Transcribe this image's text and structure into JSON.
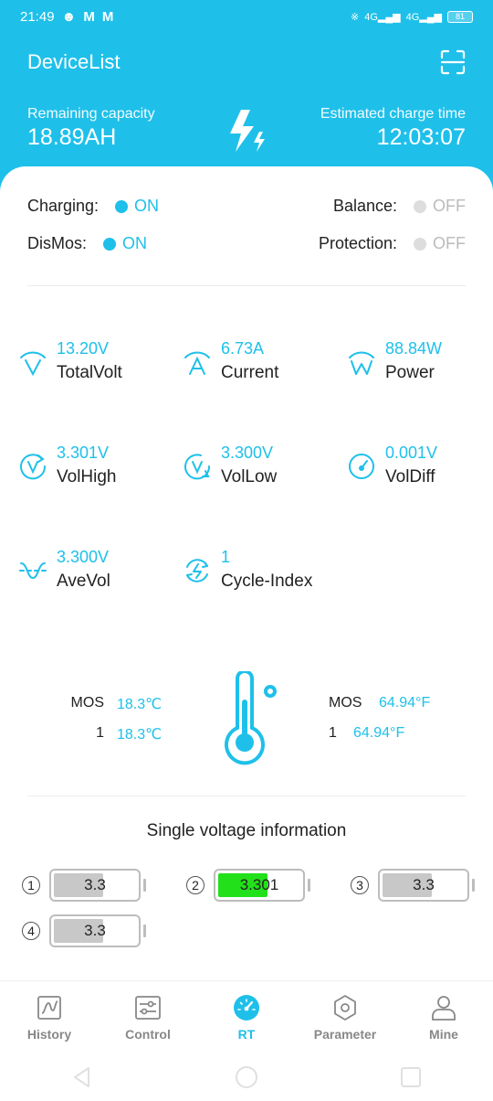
{
  "status_bar": {
    "time": "21:49",
    "left_icons": [
      "people-icon",
      "gmail-icon",
      "gmail-icon"
    ],
    "right_icons": [
      "bluetooth-icon",
      "signal-4g-icon",
      "signal-4g-icon",
      "battery-icon"
    ],
    "battery": "81"
  },
  "header": {
    "title": "DeviceList",
    "remaining_capacity_label": "Remaining capacity",
    "remaining_capacity_value": "18.89AH",
    "charge_time_label": "Estimated charge time",
    "charge_time_value": "12:03:07"
  },
  "states": {
    "charging_label": "Charging:",
    "charging_value": "ON",
    "balance_label": "Balance:",
    "balance_value": "OFF",
    "dismos_label": "DisMos:",
    "dismos_value": "ON",
    "protection_label": "Protection:",
    "protection_value": "OFF"
  },
  "metrics": [
    {
      "value": "13.20V",
      "label": "TotalVolt",
      "icon": "total-volt-icon"
    },
    {
      "value": "6.73A",
      "label": "Current",
      "icon": "current-icon"
    },
    {
      "value": "88.84W",
      "label": "Power",
      "icon": "power-icon"
    },
    {
      "value": "3.301V",
      "label": "VolHigh",
      "icon": "vol-high-icon"
    },
    {
      "value": "3.300V",
      "label": "VolLow",
      "icon": "vol-low-icon"
    },
    {
      "value": "0.001V",
      "label": "VolDiff",
      "icon": "gauge-icon"
    },
    {
      "value": "3.300V",
      "label": "AveVol",
      "icon": "ave-vol-icon"
    },
    {
      "value": "1",
      "label": "Cycle-Index",
      "icon": "cycle-icon"
    }
  ],
  "temperatures": {
    "celsius": [
      {
        "label": "MOS",
        "value": "18.3℃"
      },
      {
        "label": "1",
        "value": "18.3℃"
      }
    ],
    "fahrenheit": [
      {
        "label": "MOS",
        "value": "64.94°F"
      },
      {
        "label": "1",
        "value": "64.94°F"
      }
    ]
  },
  "single_voltage": {
    "title": "Single voltage information",
    "cells": [
      {
        "index": "1",
        "value": "3.3",
        "level": 0.6,
        "highlight": false
      },
      {
        "index": "2",
        "value": "3.301",
        "level": 0.6,
        "highlight": true
      },
      {
        "index": "3",
        "value": "3.3",
        "level": 0.6,
        "highlight": false
      },
      {
        "index": "4",
        "value": "3.3",
        "level": 0.6,
        "highlight": false
      }
    ]
  },
  "colors": {
    "accent": "#1ec0ea",
    "cell_normal": "#c8c8c8",
    "cell_highlight": "#22e01a",
    "inactive": "#888888"
  },
  "nav": {
    "items": [
      {
        "label": "History",
        "icon": "history-chart-icon",
        "active": false
      },
      {
        "label": "Control",
        "icon": "control-sliders-icon",
        "active": false
      },
      {
        "label": "RT",
        "icon": "rt-gauge-icon",
        "active": true
      },
      {
        "label": "Parameter",
        "icon": "parameter-hexagon-icon",
        "active": false
      },
      {
        "label": "Mine",
        "icon": "user-icon",
        "active": false
      }
    ]
  }
}
